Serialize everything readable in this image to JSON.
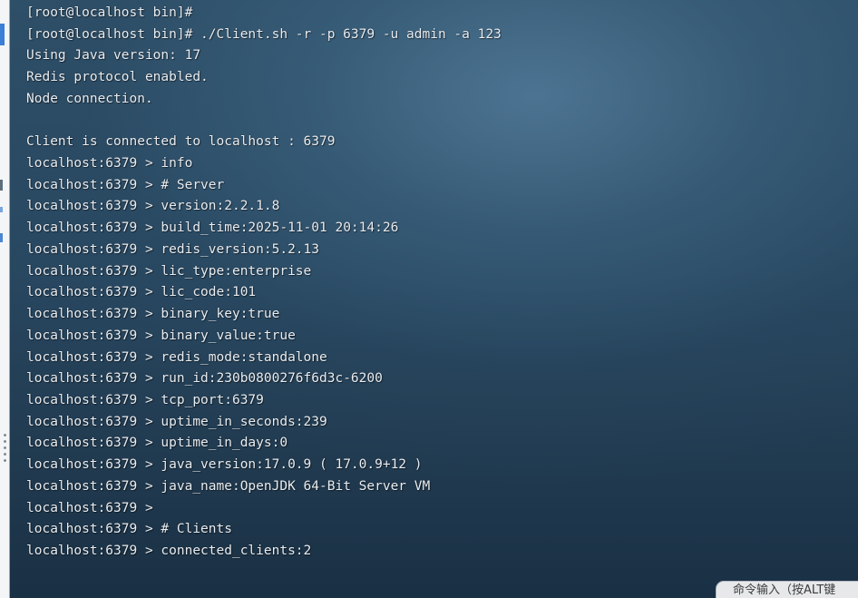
{
  "terminal": {
    "shell_prompt": "[root@localhost bin]#",
    "shell_command": "./Client.sh -r -p 6379 -u admin -a 123",
    "startup_output": [
      "Using Java version: 17",
      "Redis protocol enabled.",
      "Node connection."
    ],
    "connection_message": "Client is connected to localhost : 6379",
    "client_prompt": "localhost:6379 >",
    "client_command": "info",
    "info_output": [
      "# Server",
      "version:2.2.1.8",
      "build_time:2025-11-01 20:14:26",
      "redis_version:5.2.13",
      "lic_type:enterprise",
      "lic_code:101",
      "binary_key:true",
      "binary_value:true",
      "redis_mode:standalone",
      "run_id:230b0800276f6d3c-6200",
      "tcp_port:6379",
      "uptime_in_seconds:239",
      "uptime_in_days:0",
      "java_version:17.0.9 ( 17.0.9+12 )",
      "java_name:OpenJDK 64-Bit Server VM",
      "# Clients",
      "connected_clients:2"
    ]
  },
  "command_bar": {
    "placeholder": "命令输入（按ALT键"
  },
  "colors": {
    "terminal_text": "#e9edf1",
    "terminal_background": "#2b4a63",
    "sidebar_accent": "#3b7fd6"
  }
}
